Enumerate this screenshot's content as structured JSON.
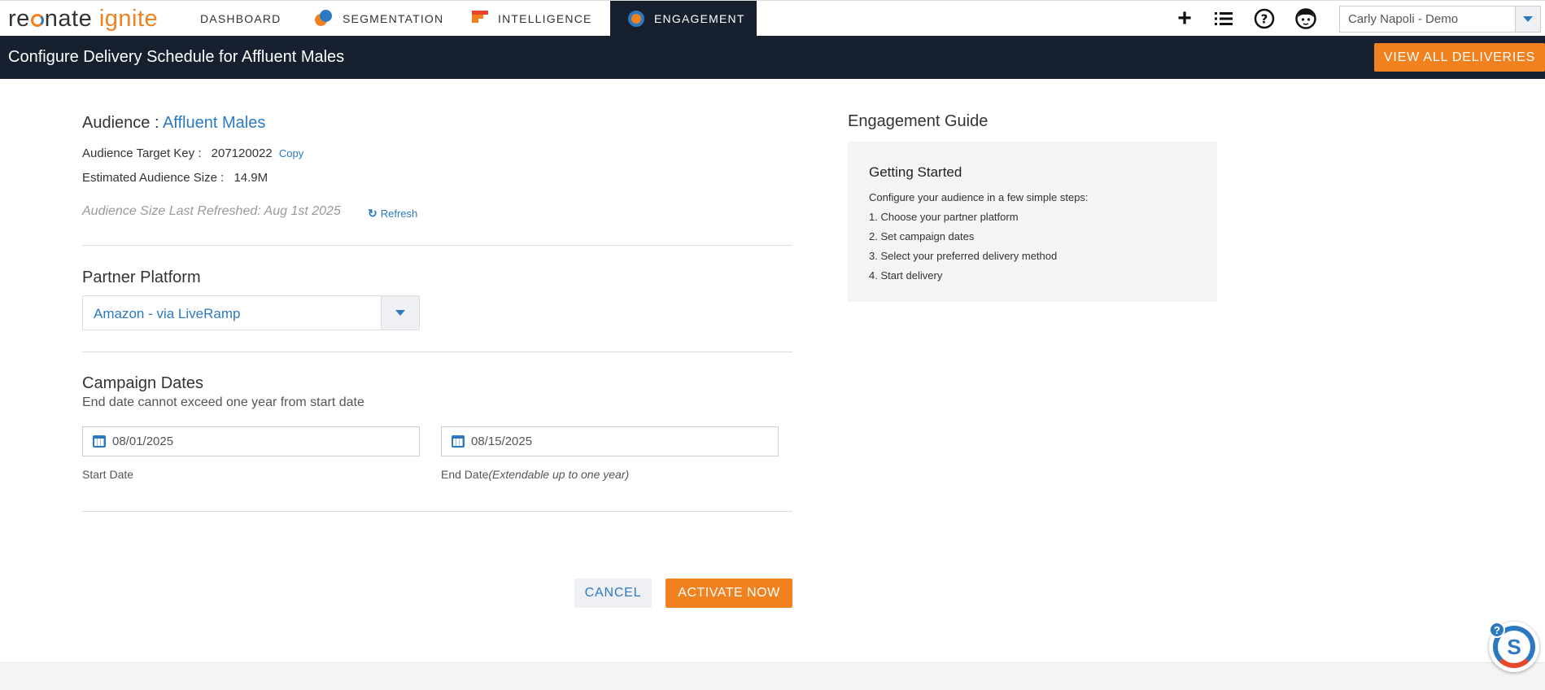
{
  "brand": {
    "word1": "re",
    "word1b": "nate",
    "word2": "ignite"
  },
  "nav": {
    "tabs": [
      {
        "label": "DASHBOARD"
      },
      {
        "label": "SEGMENTATION"
      },
      {
        "label": "INTELLIGENCE"
      },
      {
        "label": "ENGAGEMENT"
      }
    ],
    "active_tab": "ENGAGEMENT",
    "header_icons": [
      "plus-icon",
      "list-icon",
      "help-icon",
      "user-icon"
    ],
    "user_select": {
      "value": "Carly Napoli - Demo"
    }
  },
  "subheader": {
    "title": "Configure Delivery Schedule for Affluent Males",
    "view_all_label": "VIEW ALL DELIVERIES"
  },
  "audience": {
    "prefix": "Audience : ",
    "name": "Affluent Males",
    "target_key_label": "Audience Target Key :",
    "target_key_value": "207120022",
    "copy_label": "Copy",
    "size_label": "Estimated Audience Size :",
    "size_value": "14.9M",
    "refreshed_text": "Audience Size Last Refreshed: Aug 1st 2025",
    "refresh_label": "Refresh"
  },
  "partner": {
    "title": "Partner Platform",
    "selected": "Amazon - via LiveRamp"
  },
  "dates": {
    "title": "Campaign Dates",
    "note": "End date cannot exceed one year from start date",
    "start_value": "08/01/2025",
    "end_value": "08/15/2025",
    "start_label": "Start Date",
    "end_label": "End Date",
    "end_label_note": "(Extendable up to one year)"
  },
  "actions": {
    "cancel_label": "CANCEL",
    "activate_label": "ACTIVATE NOW"
  },
  "guide": {
    "title": "Engagement Guide",
    "heading": "Getting Started",
    "lines": [
      "Configure your audience in a few simple steps:",
      "1. Choose your partner platform",
      "2. Set campaign dates",
      "3. Select your preferred delivery method",
      "4. Start delivery"
    ]
  },
  "colors": {
    "accent": "#f0811e",
    "link": "#2c79c2",
    "dark": "#16202e"
  }
}
